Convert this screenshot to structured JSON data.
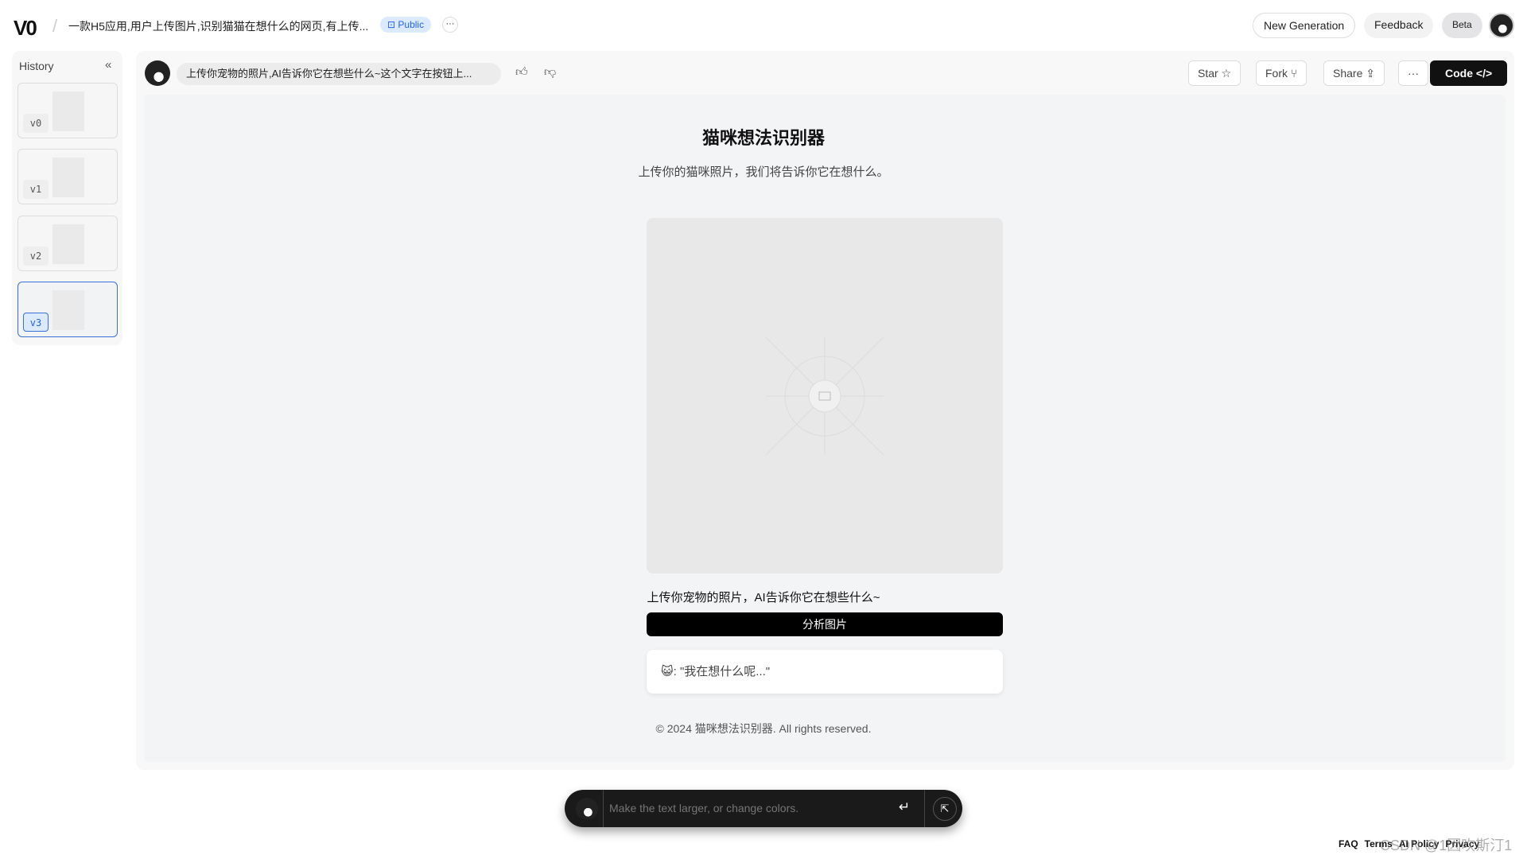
{
  "header": {
    "logo": "V0",
    "project_title": "一款H5应用,用户上传图片,识别猫猫在想什么的网页,有上传...",
    "visibility": "Public",
    "more": "···",
    "new_generation": "New Generation",
    "feedback": "Feedback",
    "beta": "Beta"
  },
  "sidebar": {
    "title": "History",
    "collapse": "«",
    "versions": [
      {
        "label": "v0"
      },
      {
        "label": "v1"
      },
      {
        "label": "v2"
      },
      {
        "label": "v3",
        "selected": true
      }
    ]
  },
  "toolbar": {
    "prompt": "上传你宠物的照片,AI告诉你它在想些什么~这个文字在按钮上...",
    "star": "Star ☆",
    "fork": "Fork ⑂",
    "share": "Share ⇪",
    "more": "···",
    "code": "Code </>"
  },
  "preview": {
    "title": "猫咪想法识别器",
    "subtitle": "上传你的猫咪照片，我们将告诉你它在想什么。",
    "upload_hint": "上传你宠物的照片，AI告诉你它在想些什么~",
    "analyze_button": "分析图片",
    "result_emoji": "😺",
    "result_text": ": \"我在想什么呢...\"",
    "footer": "© 2024 猫咪想法识别器. All rights reserved."
  },
  "chat": {
    "placeholder": "Make the text larger, or change colors.",
    "enter": "↵"
  },
  "footer_links": [
    "FAQ",
    "Terms",
    "AI Policy",
    "Privacy"
  ],
  "watermark": "CSDN @1因吹斯汀1"
}
